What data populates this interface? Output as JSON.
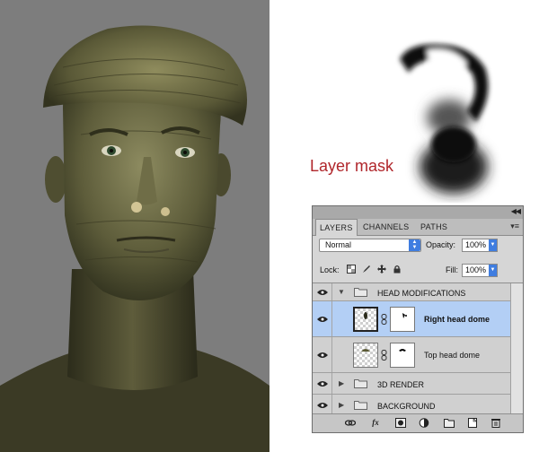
{
  "annotation": {
    "mask_label": "Layer mask"
  },
  "panel": {
    "tabs": [
      {
        "label": "LAYERS",
        "active": true
      },
      {
        "label": "CHANNELS",
        "active": false
      },
      {
        "label": "PATHS",
        "active": false
      }
    ],
    "blend_mode": "Normal",
    "opacity_label": "Opacity:",
    "opacity_value": "100%",
    "lock_label": "Lock:",
    "fill_label": "Fill:",
    "fill_value": "100%",
    "layers": [
      {
        "name": "HEAD MODIFICATIONS",
        "type": "group",
        "expanded": true,
        "visible": true
      },
      {
        "name": "Right head dome",
        "type": "layer",
        "selected": true,
        "has_mask": true,
        "visible": true,
        "bold": true
      },
      {
        "name": "Top head dome",
        "type": "layer",
        "selected": false,
        "has_mask": true,
        "visible": true
      },
      {
        "name": "3D RENDER",
        "type": "group",
        "expanded": false,
        "visible": true
      },
      {
        "name": "BACKGROUND",
        "type": "group",
        "expanded": false,
        "visible": true
      }
    ],
    "bottom_icons": [
      "link-layers-icon",
      "fx-icon",
      "add-mask-icon",
      "adjustment-icon",
      "new-group-icon",
      "new-layer-icon",
      "trash-icon"
    ]
  },
  "colors": {
    "selected_row": "#b3cff5",
    "mask_label_color": "#b0262b",
    "render_background": "#7d7d7d"
  }
}
